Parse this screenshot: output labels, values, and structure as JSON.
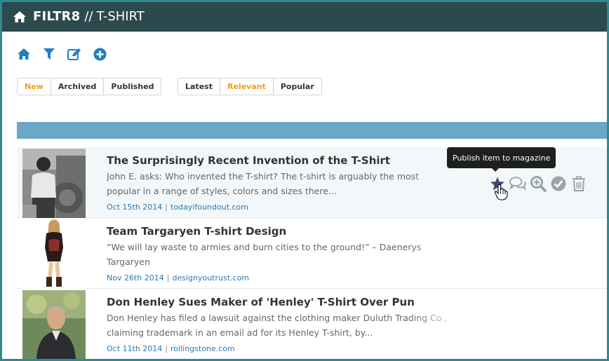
{
  "header": {
    "brand": "FILTR8",
    "separator": "//",
    "section": "T-SHIRT"
  },
  "toolbar": {
    "icons": [
      "home-icon",
      "filter-icon",
      "edit-icon",
      "add-icon"
    ],
    "accent": "#1e7fc2"
  },
  "status_filter": {
    "options": [
      "New",
      "Archived",
      "Published"
    ],
    "active": "New"
  },
  "sort_filter": {
    "options": [
      "Latest",
      "Relevant",
      "Popular"
    ],
    "active": "Relevant"
  },
  "colors": {
    "topbar": "#2c4a4d",
    "active": "#f39c1f",
    "bluebar": "#6ba7c7",
    "link": "#2a7ab0"
  },
  "tooltip": "Publish item to magazine",
  "items": [
    {
      "title": "The Surprisingly Recent Invention of the T-Shirt",
      "excerpt": "John E. asks: Who invented the T-shirt? The t-shirt is arguably the most popular in a range of styles, colors and sizes there...",
      "date": "Oct 15th 2014",
      "source": "todayifoundout.com"
    },
    {
      "title": "Team Targaryen T-shirt Design",
      "excerpt": "“We will lay waste to armies and burn cities to the ground!” – Daenerys Targaryen",
      "date": "Nov 26th 2014",
      "source": "designyoutrust.com"
    },
    {
      "title": "Don Henley Sues Maker of 'Henley' T-Shirt Over Pun",
      "excerpt": "Don Henley has filed a lawsuit against the clothing maker Duluth Trading Co., claiming trademark in an email ad for its Henley T-shirt, by...",
      "date": "Oct 11th 2014",
      "source": "rollingstone.com"
    }
  ],
  "actions": [
    "publish-star-icon",
    "comments-icon",
    "zoom-in-icon",
    "approve-check-icon",
    "trash-icon"
  ]
}
